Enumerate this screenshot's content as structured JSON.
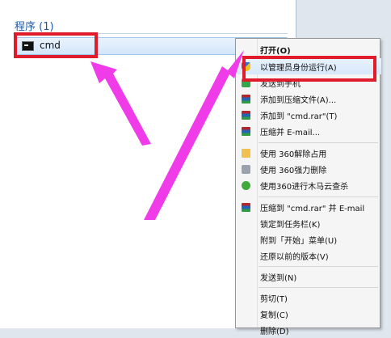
{
  "results": {
    "header": "程序 (1)",
    "items": [
      {
        "label": "cmd"
      }
    ]
  },
  "menu": {
    "items": [
      {
        "label": "打开(O)",
        "icon": "none",
        "bold": true
      },
      {
        "label": "以管理员身份运行(A)",
        "icon": "uac-shield-icon",
        "hover": true
      },
      {
        "label": "发送到手机",
        "icon": "phone-icon"
      },
      {
        "label": "添加到压缩文件(A)...",
        "icon": "winrar-icon"
      },
      {
        "label": "添加到 \"cmd.rar\"(T)",
        "icon": "winrar-icon"
      },
      {
        "label": "压缩并 E-mail...",
        "icon": "winrar-icon"
      },
      {
        "label": "使用 360解除占用",
        "icon": "folder-icon"
      },
      {
        "label": "使用 360强力删除",
        "icon": "shredder-icon"
      },
      {
        "label": "使用360进行木马云查杀",
        "icon": "360-icon"
      },
      {
        "label": "压缩到 \"cmd.rar\" 并 E-mail",
        "icon": "winrar-icon"
      },
      {
        "label": "锁定到任务栏(K)",
        "icon": "none"
      },
      {
        "label": "附到「开始」菜单(U)",
        "icon": "none"
      },
      {
        "label": "还原以前的版本(V)",
        "icon": "none"
      },
      {
        "label": "发送到(N)",
        "icon": "none"
      },
      {
        "label": "剪切(T)",
        "icon": "none"
      },
      {
        "label": "复制(C)",
        "icon": "none"
      },
      {
        "label": "删除(D)",
        "icon": "none"
      }
    ]
  },
  "colors": {
    "highlight": "#e01b2b",
    "arrow": "#f03ce8"
  }
}
